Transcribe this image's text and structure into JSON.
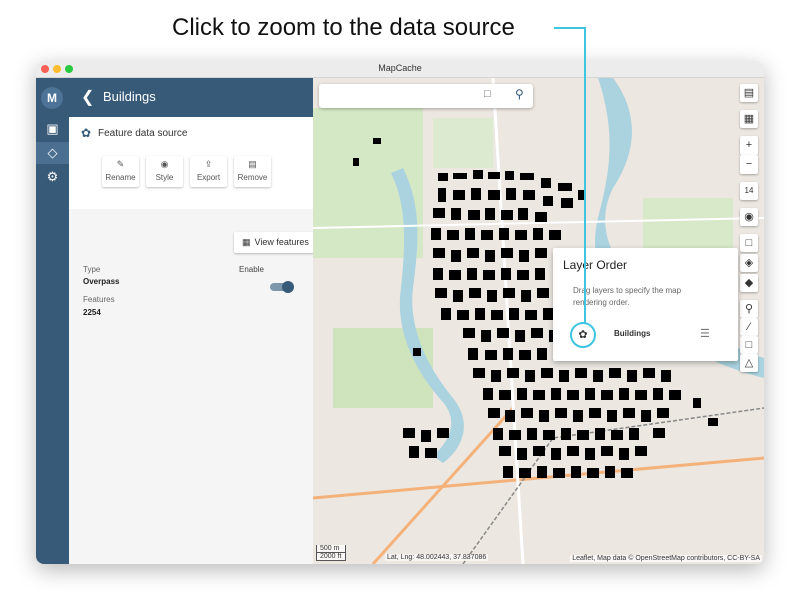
{
  "annotation": {
    "caption": "Click to zoom to the data source",
    "accent_color": "#3ec6e0"
  },
  "window": {
    "title": "MapCache"
  },
  "rail": {
    "items": [
      {
        "icon": "map-logo-icon"
      },
      {
        "icon": "cube-icon"
      },
      {
        "icon": "layers-icon",
        "active": true
      },
      {
        "icon": "gear-icon"
      }
    ]
  },
  "panel": {
    "header_title": "Buildings",
    "back_icon": "chevron-left-icon",
    "source_label": "Feature data source",
    "actions": [
      {
        "label": "Rename",
        "icon": "pencil-icon"
      },
      {
        "label": "Style",
        "icon": "palette-icon"
      },
      {
        "label": "Export",
        "icon": "export-icon"
      },
      {
        "label": "Remove",
        "icon": "trash-icon"
      }
    ],
    "type_label": "Type",
    "type_value": "Overpass",
    "enable_label": "Enable",
    "enabled": true,
    "features_label": "Features",
    "features_value": "2254",
    "view_features_label": "View features"
  },
  "map": {
    "search_placeholder": "",
    "layer_order": {
      "title": "Layer Order",
      "description": "Drag layers to specify the map rendering order.",
      "layer_name": "Buildings"
    },
    "tools": [
      {
        "icon": "map-icon"
      },
      {
        "icon": "grid-icon"
      },
      {
        "icon": "zoom-in-icon",
        "text": "+"
      },
      {
        "icon": "zoom-out-icon",
        "text": "−"
      },
      {
        "icon": "zoom-level",
        "text": "14"
      },
      {
        "icon": "camera-icon"
      },
      {
        "icon": "fit-extent-icon"
      },
      {
        "icon": "layers-off-icon"
      },
      {
        "icon": "layers-icon"
      },
      {
        "icon": "marker-icon"
      },
      {
        "icon": "line-icon"
      },
      {
        "icon": "rectangle-icon"
      },
      {
        "icon": "polygon-icon"
      }
    ],
    "scale_metric": "500 m",
    "scale_imperial": "2000 ft",
    "coordinates": "Lat, Lng: 48.002443, 37.837086",
    "attribution": "Leaflet, Map data © OpenStreetMap contributors, CC-BY-SA"
  },
  "colors": {
    "sidebar": "#375a78",
    "water": "#aad3df",
    "park": "#c8e2b3",
    "buildings": "#000000"
  }
}
